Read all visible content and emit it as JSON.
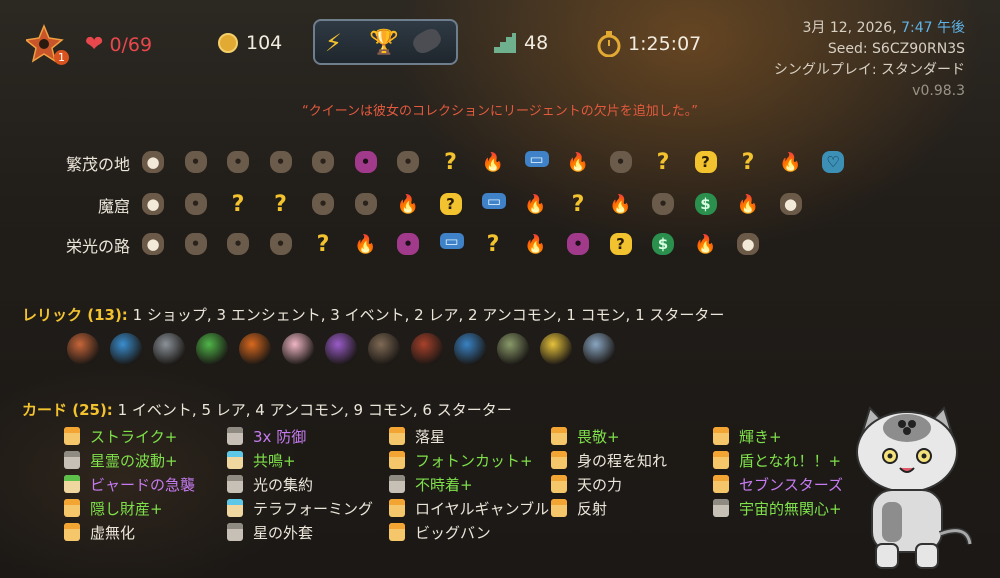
{
  "hud": {
    "character_icon": "flame-star-icon",
    "ascension_badge": "1",
    "hp_icon": "heart-icon",
    "hp": "0/69",
    "gold_icon": "coin-icon",
    "gold": "104",
    "relic_slots": [
      "lightning-quill-icon",
      "golden-trophy-icon",
      "dark-bomb-icon"
    ],
    "floor_icon": "stairs-icon",
    "floor": "48",
    "time_icon": "stopwatch-icon",
    "time": "1:25:07"
  },
  "info": {
    "date": "3月 12, 2026,",
    "time": "7:47 午後",
    "seed_label": "Seed:",
    "seed": "S6CZ90RN3S",
    "mode": "シングルプレイ: スタンダード",
    "version": "v0.98.3"
  },
  "quote": "“クイーンは彼女のコレクションにリージェントの欠片を追加した。”",
  "acts": [
    {
      "name": "繁茂の地",
      "nodes": [
        "boss",
        "m",
        "m",
        "m",
        "m",
        "e",
        "m",
        "q",
        "f",
        "s",
        "f",
        "m",
        "q",
        "eq",
        "q",
        "f",
        "b"
      ]
    },
    {
      "name": "魔窟",
      "nodes": [
        "boss",
        "m",
        "q",
        "q",
        "m",
        "m",
        "f",
        "eq",
        "s",
        "f",
        "q",
        "f",
        "m",
        "t",
        "f",
        "boss"
      ]
    },
    {
      "name": "栄光の路",
      "nodes": [
        "boss",
        "m",
        "m",
        "m",
        "q",
        "f",
        "e",
        "s",
        "q",
        "f",
        "e",
        "eq",
        "t",
        "f",
        "boss"
      ]
    }
  ],
  "node_icons": {
    "m": "monster-icon",
    "q": "unknown-event-icon",
    "f": "rest-site-icon",
    "e": "elite-icon",
    "s": "shop-icon",
    "t": "treasure-icon",
    "eq": "ancient-icon",
    "b": "blue-boss-icon",
    "boss": "boss-icon"
  },
  "relics": {
    "label": "レリック (13):",
    "summary": "1 ショップ, 3 エンシェント, 3 イベント, 2 レア, 2 アンコモン, 1 コモン, 1 スターター",
    "items": [
      {
        "icon": "burning-stone-icon",
        "color": "#c7663a"
      },
      {
        "icon": "swirl-orb-icon",
        "color": "#3a8ed0"
      },
      {
        "icon": "shuriken-icon",
        "color": "#8b929a"
      },
      {
        "icon": "parrot-icon",
        "color": "#4fb548"
      },
      {
        "icon": "pumpkin-icon",
        "color": "#d9691f"
      },
      {
        "icon": "ice-cream-icon",
        "color": "#f0b6c6"
      },
      {
        "icon": "voodoo-doll-icon",
        "color": "#9a5cc9"
      },
      {
        "icon": "price-tag-icon",
        "color": "#7f6a55"
      },
      {
        "icon": "axe-icon",
        "color": "#a8412b"
      },
      {
        "icon": "anchor-icon",
        "color": "#3a82c4"
      },
      {
        "icon": "frog-icon",
        "color": "#8a9a6a"
      },
      {
        "icon": "bell-flower-icon",
        "color": "#e6c23c"
      },
      {
        "icon": "hourglass-icon",
        "color": "#8aa6c2"
      }
    ]
  },
  "cards": {
    "label": "カード (25):",
    "summary": "1 イベント, 5 レア, 4 アンコモン, 9 コモン, 6 スターター",
    "columns": [
      [
        {
          "name": "ストライク+",
          "style": "green",
          "icon": "gold"
        },
        {
          "name": "星霊の波動+",
          "style": "green",
          "icon": "grey"
        },
        {
          "name": "ビャードの急襲",
          "style": "purple",
          "icon": "green"
        },
        {
          "name": "隠し財産+",
          "style": "green",
          "icon": "gold"
        },
        {
          "name": "虚無化",
          "style": "white",
          "icon": "gold"
        }
      ],
      [
        {
          "name": "3x 防御",
          "style": "purple",
          "icon": "grey"
        },
        {
          "name": "共鳴+",
          "style": "green",
          "icon": "blue"
        },
        {
          "name": "光の集約",
          "style": "white",
          "icon": "grey"
        },
        {
          "name": "テラフォーミング",
          "style": "white",
          "icon": "blue"
        },
        {
          "name": "星の外套",
          "style": "white",
          "icon": "grey"
        }
      ],
      [
        {
          "name": "落星",
          "style": "white",
          "icon": "gold"
        },
        {
          "name": "フォトンカット+",
          "style": "green",
          "icon": "gold"
        },
        {
          "name": "不時着+",
          "style": "green",
          "icon": "grey"
        },
        {
          "name": "ロイヤルギャンブル",
          "style": "white",
          "icon": "gold"
        },
        {
          "name": "ビッグバン",
          "style": "white",
          "icon": "gold"
        }
      ],
      [
        {
          "name": "畏敬+",
          "style": "green",
          "icon": "gold"
        },
        {
          "name": "身の程を知れ",
          "style": "white",
          "icon": "gold"
        },
        {
          "name": "天の力",
          "style": "white",
          "icon": "gold"
        },
        {
          "name": "反射",
          "style": "white",
          "icon": "gold"
        }
      ],
      [
        {
          "name": "輝き+",
          "style": "green",
          "icon": "gold"
        },
        {
          "name": "盾となれ！！+",
          "style": "green",
          "icon": "gold"
        },
        {
          "name": "セブンスターズ",
          "style": "purple",
          "icon": "gold"
        },
        {
          "name": "宇宙的無関心+",
          "style": "green",
          "icon": "grey"
        }
      ]
    ]
  },
  "mascot": "grey-cat-icon"
}
